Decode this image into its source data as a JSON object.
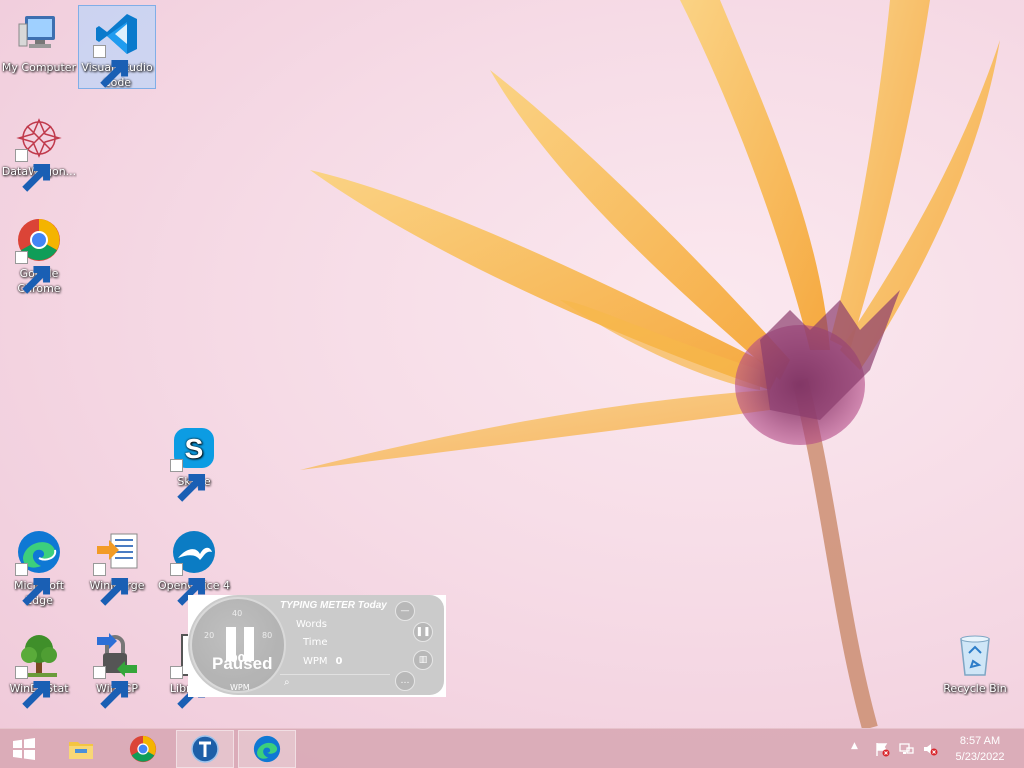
{
  "desktop": {
    "icons": [
      {
        "label": "My Computer",
        "icon": "computer-icon"
      },
      {
        "label": "Visual Studio Code",
        "icon": "vscode-icon",
        "selected": true
      },
      {
        "label": "DataWagon...",
        "icon": "datawagon-icon"
      },
      {
        "label": "Google Chrome",
        "icon": "chrome-icon"
      },
      {
        "label": "Skype",
        "icon": "skype-icon"
      },
      {
        "label": "Microsoft Edge",
        "icon": "edge-icon"
      },
      {
        "label": "WinMerge",
        "icon": "winmerge-icon"
      },
      {
        "label": "OpenOffice 4",
        "icon": "openoffice-icon"
      },
      {
        "label": "WinDirStat",
        "icon": "windirstat-icon"
      },
      {
        "label": "WinSCP",
        "icon": "winscp-icon"
      },
      {
        "label": "Libre 7.3",
        "icon": "libreoffice-icon"
      },
      {
        "label": "Recycle Bin",
        "icon": "recycle-bin-icon"
      }
    ]
  },
  "typing_meter": {
    "title": "TYPING METER Today",
    "words_label": "Words",
    "time_label": "Time",
    "wpm_label": "WPM",
    "wpm_value": "0",
    "dial_value": "00",
    "status": "Paused",
    "dial_unit": "WPM",
    "ticks": [
      "20",
      "40",
      "60",
      "80"
    ]
  },
  "taskbar": {
    "start": "start-icon",
    "pinned": [
      "file-explorer-icon",
      "chrome-icon",
      "typing-meter-icon",
      "edge-icon"
    ],
    "clock_time": "8:57 AM",
    "clock_date": "5/23/2022",
    "tray": [
      "show-hidden-icons",
      "action-center-flag-icon",
      "network-icon",
      "volume-muted-icon"
    ]
  },
  "colors": {
    "taskbar": "#d9a9b5",
    "accent": "#1a73e8"
  }
}
